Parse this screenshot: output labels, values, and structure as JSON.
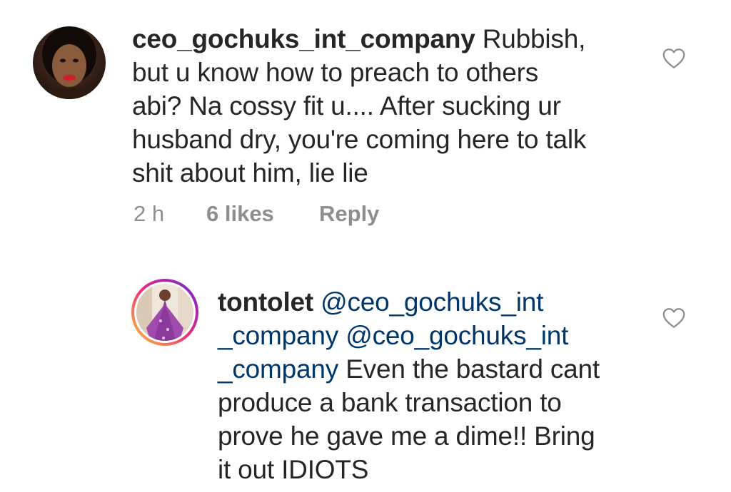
{
  "comments": [
    {
      "username": "ceo_gochuks_int_company",
      "lines": [
        " Rubbish,",
        "but u know how to preach to others",
        "abi? Na cossy fit u.... After sucking ur",
        "husband dry, you're coming here to talk",
        "shit about him, lie lie"
      ],
      "time": "2 h",
      "likes": "6 likes",
      "reply_label": "Reply"
    },
    {
      "username": "tontolet",
      "line1_mention": " @ceo_gochuks_int",
      "line2_mention1": "_company",
      "line2_mention2": " @ceo_gochuks_int",
      "line3_mention": "_company",
      "line3_text": " Even the bastard cant",
      "lines_rest": [
        "produce a bank transaction to",
        "prove he gave me a dime!! Bring",
        "it out  IDIOTS"
      ]
    }
  ],
  "icons": {
    "like": "heart-outline-icon"
  },
  "colors": {
    "text": "#262626",
    "meta": "#8e8e8e",
    "mention": "#00376b",
    "story_ring_start": "#f9ce34",
    "story_ring_end": "#ee2a7b"
  }
}
